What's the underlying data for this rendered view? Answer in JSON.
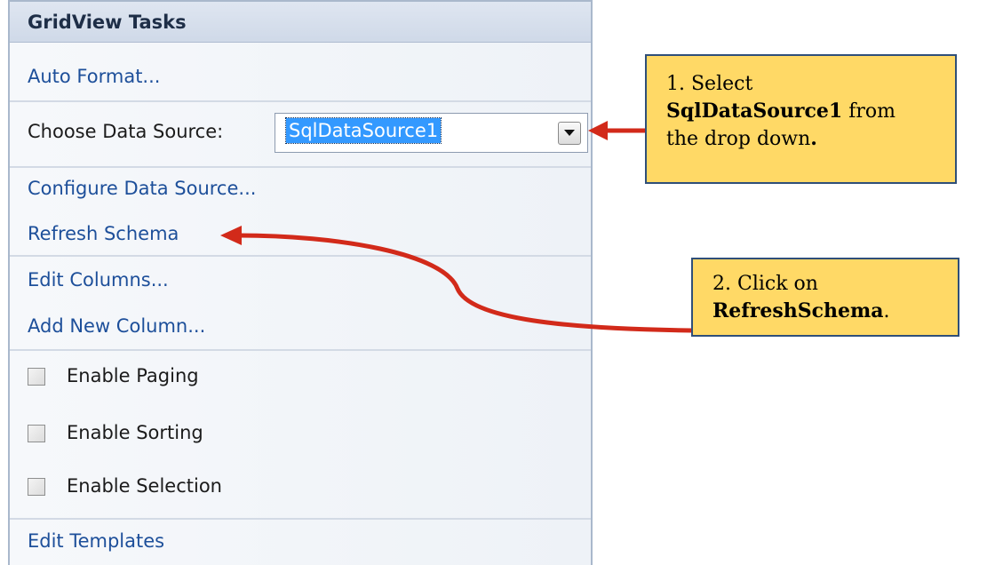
{
  "panel": {
    "title": "GridView Tasks",
    "auto_format": "Auto Format...",
    "choose_label": "Choose Data Source:",
    "data_source_value": "SqlDataSource1",
    "configure": "Configure Data Source...",
    "refresh": "Refresh Schema",
    "edit_columns": "Edit Columns...",
    "add_column": "Add New Column...",
    "paging": "Enable Paging",
    "sorting": "Enable Sorting",
    "selection": "Enable Selection",
    "edit_templates": "Edit Templates"
  },
  "callouts": {
    "one": {
      "line1": "1. Select",
      "bold": "SqlDataSource1",
      "line2": " from",
      "line3": "the drop down",
      "end": "."
    },
    "two": {
      "line1": "2. Click on",
      "bold": "RefreshSchema",
      "end": "."
    }
  },
  "colors": {
    "arrow": "#d22a1a",
    "callout_fill": "#ffd966",
    "link": "#1d4f9a",
    "selection": "#3399ff"
  },
  "icons": {
    "dropdown": "chevron-down-icon",
    "arrow": "red-arrow"
  }
}
